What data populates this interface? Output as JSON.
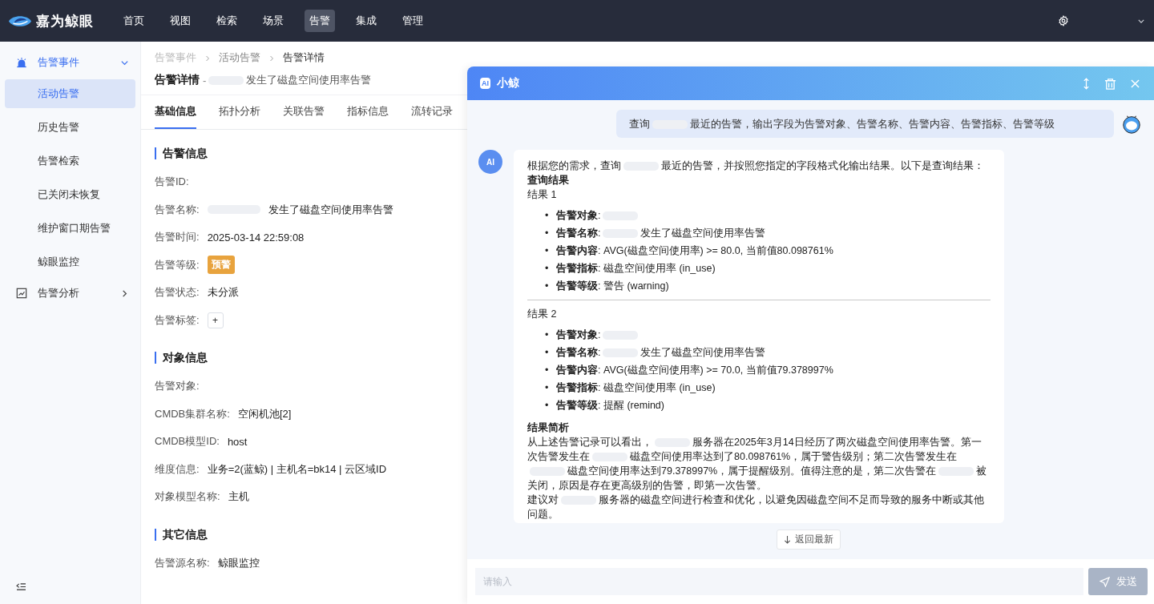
{
  "topbar": {
    "logo": "嘉为鲸眼",
    "nav": [
      {
        "label": "首页",
        "selected": false
      },
      {
        "label": "视图",
        "selected": false
      },
      {
        "label": "检索",
        "selected": false
      },
      {
        "label": "场景",
        "selected": false
      },
      {
        "label": "告警",
        "selected": true
      },
      {
        "label": "集成",
        "selected": false
      },
      {
        "label": "管理",
        "selected": false
      }
    ]
  },
  "sidebar": {
    "groups": [
      {
        "label": "告警事件",
        "kind": "alarm",
        "expanded": true,
        "children": [
          {
            "label": "活动告警",
            "selected": true
          },
          {
            "label": "历史告警",
            "selected": false
          },
          {
            "label": "告警检索",
            "selected": false
          },
          {
            "label": "已关闭未恢复",
            "selected": false
          },
          {
            "label": "维护窗口期告警",
            "selected": false
          },
          {
            "label": "鲸眼监控",
            "selected": false
          }
        ]
      },
      {
        "label": "告警分析",
        "kind": "chart",
        "expanded": false
      }
    ]
  },
  "breadcrumb": [
    "告警事件",
    "活动告警",
    "告警详情"
  ],
  "page_title": {
    "title": "告警详情",
    "separator": "-",
    "subtitle": "发生了磁盘空间使用率告警"
  },
  "tabs": [
    {
      "label": "基础信息",
      "selected": true
    },
    {
      "label": "拓扑分析",
      "selected": false
    },
    {
      "label": "关联告警",
      "selected": false
    },
    {
      "label": "指标信息",
      "selected": false
    },
    {
      "label": "流转记录",
      "selected": false
    }
  ],
  "sections": [
    {
      "title": "告警信息",
      "fields": [
        {
          "label": "告警ID:",
          "kind": "text"
        },
        {
          "label": "告警名称:",
          "kind": "text",
          "value": "发生了磁盘空间使用率告警",
          "redacted_before": true
        },
        {
          "label": "告警时间:",
          "kind": "text",
          "value": "2025-03-14 22:59:08"
        },
        {
          "label": "告警等级:",
          "kind": "badge",
          "value": "预警"
        },
        {
          "label": "告警状态:",
          "kind": "text",
          "value": "未分派"
        },
        {
          "label": "告警标签:",
          "kind": "add",
          "value": "+"
        }
      ]
    },
    {
      "title": "对象信息",
      "fields": [
        {
          "label": "告警对象:",
          "kind": "text"
        },
        {
          "label": "CMDB集群名称:",
          "kind": "text",
          "value": "空闲机池[2]"
        },
        {
          "label": "CMDB模型ID:",
          "kind": "text",
          "value": "host"
        },
        {
          "label": "维度信息:",
          "kind": "text",
          "value": "业务=2(蓝鲸) | 主机名=bk14 | 云区域ID"
        },
        {
          "label": "对象模型名称:",
          "kind": "text",
          "value": "主机"
        }
      ]
    },
    {
      "title": "其它信息",
      "fields": [
        {
          "label": "告警源名称:",
          "kind": "text",
          "value": "鲸眼监控"
        }
      ]
    }
  ],
  "chat": {
    "badge": "AI",
    "title": "小鲸",
    "user_message": [
      "查询",
      "最近的告警，输出字段为告警对象、告警名称、告警内容、告警指标、告警等级"
    ],
    "reply": {
      "avatar": "AI",
      "intro": [
        "根据您的需求，查询",
        "最近的告警，并按照您指定的字段格式化输出结果。以下是查询结果："
      ],
      "heading": "查询结果",
      "results": [
        {
          "title": "结果 1",
          "items": [
            {
              "marker": "•",
              "label": "**告警对象**:",
              "redacted_before": true
            },
            {
              "marker": "•",
              "label": "**告警名称**:",
              "value": "发生了磁盘空间使用率告警",
              "redacted_before": true
            },
            {
              "marker": "•",
              "label": "**告警内容**:",
              "value": "AVG(磁盘空间使用率) >= 80.0, 当前值80.098761%"
            },
            {
              "marker": "•",
              "label": "**告警指标**:",
              "value": "磁盘空间使用率 (in_use)"
            },
            {
              "marker": "•",
              "label": "**告警等级**:",
              "value": "警告 (warning)"
            }
          ]
        },
        {
          "title": "结果 2",
          "items": [
            {
              "marker": "•",
              "label": "**告警对象**:",
              "redacted_before": true
            },
            {
              "marker": "•",
              "label": "**告警名称**:",
              "value": "发生了磁盘空间使用率告警",
              "redacted_before": true
            },
            {
              "marker": "•",
              "label": "**告警内容**:",
              "value": "AVG(磁盘空间使用率) >= 70.0, 当前值79.378997%"
            },
            {
              "marker": "•",
              "label": "**告警指标**:",
              "value": "磁盘空间使用率 (in_use)"
            },
            {
              "marker": "•",
              "label": "**告警等级**:",
              "value": "提醒 (remind)"
            }
          ]
        }
      ],
      "summary_heading": "结果简析",
      "summary": [
        [
          "从上述告警记录可以看出，",
          "服务器在2025年3月14日经历了两次磁盘空间使用率告警。第一次告警发生在",
          "磁盘空间使用率达到了80.098761%，属于警告级别；第二次告警发生在",
          "磁盘空间使用率达到79.378997%，属于提醒级别。值得注意的是，第二次告警在",
          "被关闭，原因是存在更高级别的告警，即第一次告警。"
        ],
        [
          "建议对",
          "服务器的磁盘空间进行检查和优化，以避免因磁盘空间不足而导致的服务中断或其他问题。"
        ]
      ]
    },
    "back_to_latest": "返回最新",
    "input": {
      "placeholder": "请输入"
    },
    "send": {
      "label": "发送",
      "disabled": true
    }
  }
}
